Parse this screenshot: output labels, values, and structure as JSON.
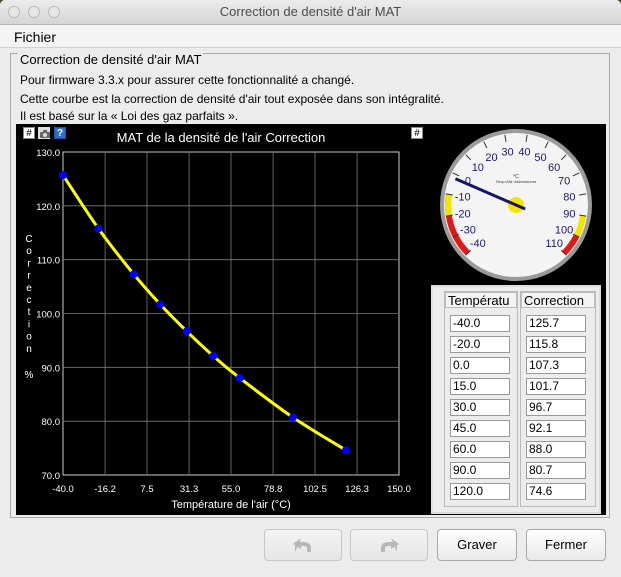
{
  "window": {
    "title": "Correction de densité d'air MAT"
  },
  "menu": {
    "file": "Fichier"
  },
  "panel": {
    "title": "Correction de densité d'air MAT",
    "desc1": "Pour firmware 3.3.x pour assurer cette fonctionnalité a changé.",
    "desc2": "Cette courbe est la correction de densité d'air tout exposée dans son intégralité.",
    "desc3": "Il est basé sur la « Loi des gaz parfaits »."
  },
  "toolbar_icons": {
    "hash_left": "#",
    "camera": "camera-icon",
    "help": "?",
    "hash_right": "#"
  },
  "chart_data": {
    "type": "line",
    "title": "MAT de la densité de l'air Correction",
    "xlabel": "Température de l'air (°C)",
    "ylabel": "Correction %",
    "x_ticks": [
      "-40.0",
      "-16.2",
      "7.5",
      "31.3",
      "55.0",
      "78.8",
      "102.5",
      "126.3",
      "150.0"
    ],
    "y_ticks": [
      "130.0",
      "120.0",
      "110.0",
      "100.0",
      "90.0",
      "80.0",
      "70.0"
    ],
    "xlim": [
      -40,
      150
    ],
    "ylim": [
      70,
      130
    ],
    "x": [
      -40,
      -20,
      0,
      15,
      30,
      45,
      60,
      90,
      120
    ],
    "y": [
      125.7,
      115.8,
      107.3,
      101.7,
      96.7,
      92.1,
      88.0,
      80.7,
      74.6
    ],
    "line_color": "#ffff00",
    "point_color": "#0000ff",
    "grid": true
  },
  "gauge": {
    "title": "°C",
    "subtitle": "Temp d'Air d'admissiones",
    "ticks": [
      "-40",
      "-30",
      "-20",
      "-10",
      "0",
      "10",
      "20",
      "30",
      "40",
      "50",
      "60",
      "70",
      "80",
      "90",
      "100",
      "110"
    ],
    "value": -2
  },
  "table": {
    "headers": [
      "Températu",
      "Correction"
    ],
    "temps": [
      "-40.0",
      "-20.0",
      "0.0",
      "15.0",
      "30.0",
      "45.0",
      "60.0",
      "90.0",
      "120.0"
    ],
    "corrections": [
      "125.7",
      "115.8",
      "107.3",
      "101.7",
      "96.7",
      "92.1",
      "88.0",
      "80.7",
      "74.6"
    ]
  },
  "buttons": {
    "burn": "Graver",
    "close": "Fermer"
  }
}
